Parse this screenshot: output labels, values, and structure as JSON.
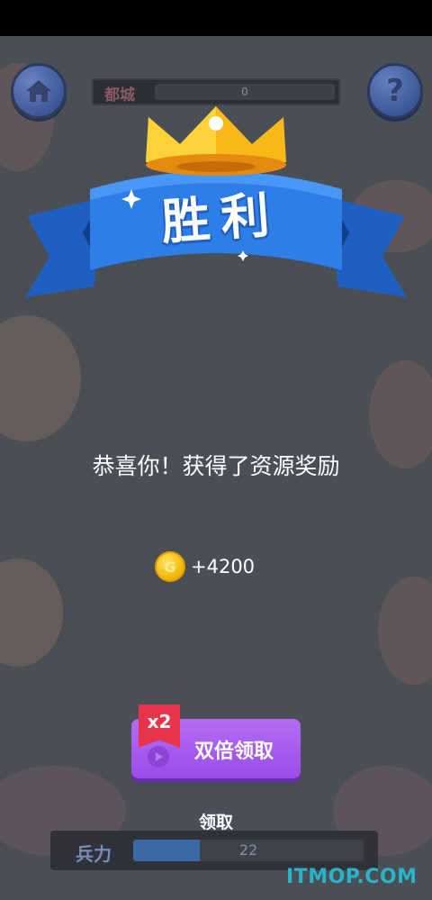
{
  "header": {
    "city_label": "都城",
    "city_value": "0",
    "help_glyph": "?"
  },
  "victory": {
    "title": "胜利"
  },
  "message": "恭喜你！获得了资源奖励",
  "reward": {
    "coin_glyph": "G",
    "amount": "+4200"
  },
  "double_claim": {
    "badge": "x2",
    "label": "双倍领取"
  },
  "claim_label": "领取",
  "troops": {
    "label": "兵力",
    "value": "22",
    "fill_fraction": 0.29
  },
  "watermark": "ITMOP.COM",
  "colors": {
    "overlay": "#4a4f55",
    "ribbon_blue": "#2f7ee8",
    "crown_gold": "#f6b918",
    "button_purple": "#a85cf0",
    "badge_red": "#e7344b",
    "watermark_cyan": "#27b3c8"
  }
}
